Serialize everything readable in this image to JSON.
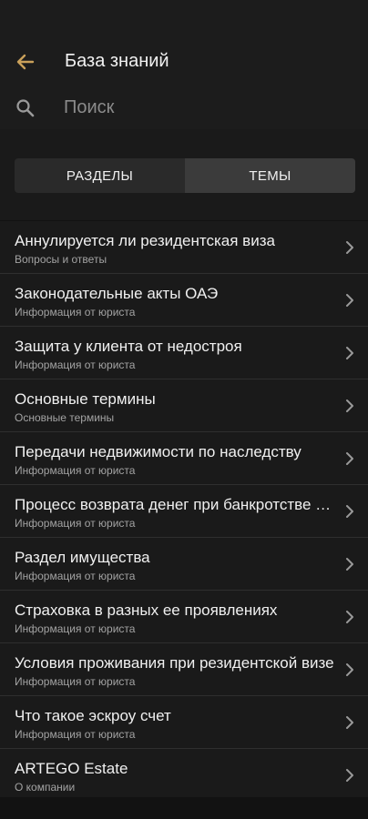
{
  "header": {
    "title": "База знаний",
    "back_icon": "arrow-left-icon",
    "accent_color": "#c9a05a"
  },
  "search": {
    "placeholder": "Поиск",
    "value": "",
    "icon": "search-icon"
  },
  "tabs": [
    {
      "label": "РАЗДЕЛЫ",
      "active": false
    },
    {
      "label": "ТЕМЫ",
      "active": true
    }
  ],
  "items": [
    {
      "title": "Аннулируется ли резидентская виза",
      "subtitle": "Вопросы и ответы"
    },
    {
      "title": "Законодательные акты ОАЭ",
      "subtitle": "Информация от юриста"
    },
    {
      "title": "Защита у клиента от недостроя",
      "subtitle": "Информация от юриста"
    },
    {
      "title": "Основные термины",
      "subtitle": "Основные термины"
    },
    {
      "title": "Передачи недвижимости по наследству",
      "subtitle": "Информация от юриста"
    },
    {
      "title": "Процесс возврата денег при банкротстве застройщика",
      "subtitle": "Информация от юриста"
    },
    {
      "title": "Раздел имущества",
      "subtitle": "Информация от юриста"
    },
    {
      "title": "Страховка в разных ее проявлениях",
      "subtitle": "Информация от юриста"
    },
    {
      "title": "Условия проживания при резидентской визе",
      "subtitle": "Информация от юриста"
    },
    {
      "title": "Что такое эскроу счет",
      "subtitle": "Информация от юриста"
    },
    {
      "title": "ARTEGO Estate",
      "subtitle": "О компании"
    }
  ]
}
